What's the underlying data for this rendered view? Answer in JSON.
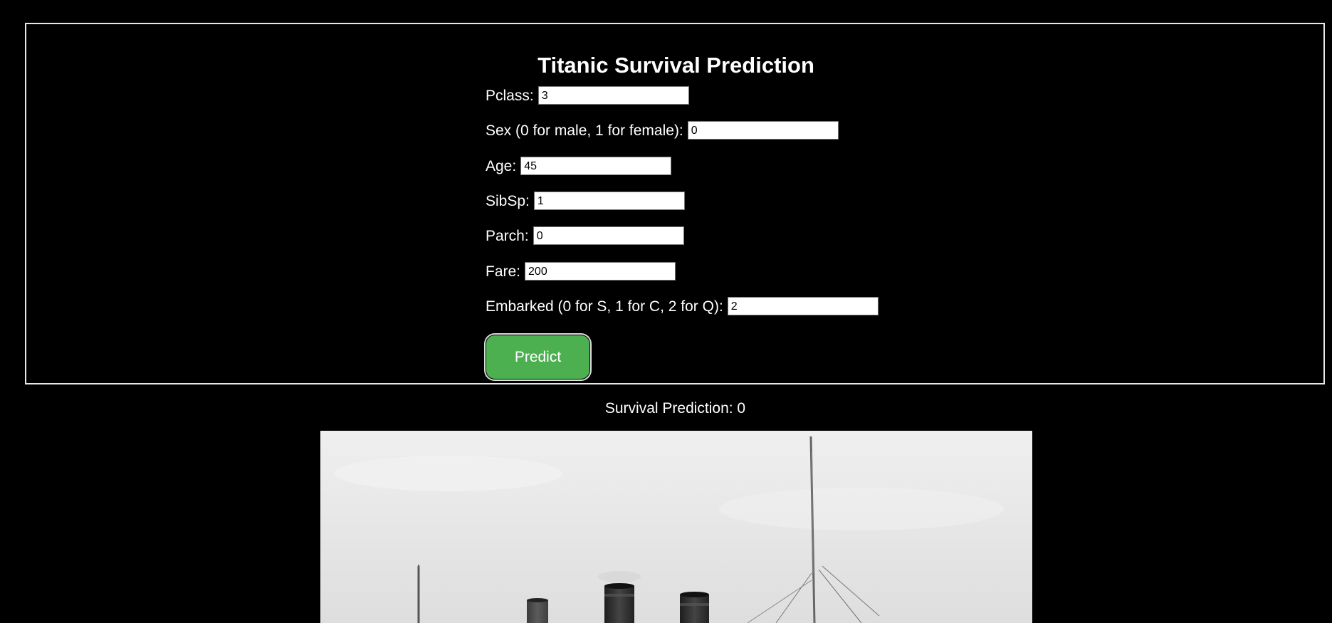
{
  "page": {
    "title": "Titanic Survival Prediction"
  },
  "form": {
    "fields": [
      {
        "label": "Pclass:",
        "value": "3"
      },
      {
        "label": "Sex (0 for male, 1 for female):",
        "value": "0"
      },
      {
        "label": "Age:",
        "value": "45"
      },
      {
        "label": "SibSp:",
        "value": "1"
      },
      {
        "label": "Parch:",
        "value": "0"
      },
      {
        "label": "Fare:",
        "value": "200"
      },
      {
        "label": "Embarked (0 for S, 1 for C, 2 for Q):",
        "value": "2"
      }
    ],
    "submit_label": "Predict"
  },
  "result": {
    "text": "Survival Prediction: 0"
  },
  "image": {
    "icon": "titanic-ship-photo",
    "colors": {
      "sky": "#e6e6e6",
      "funnel": "#2b2b2b"
    }
  }
}
